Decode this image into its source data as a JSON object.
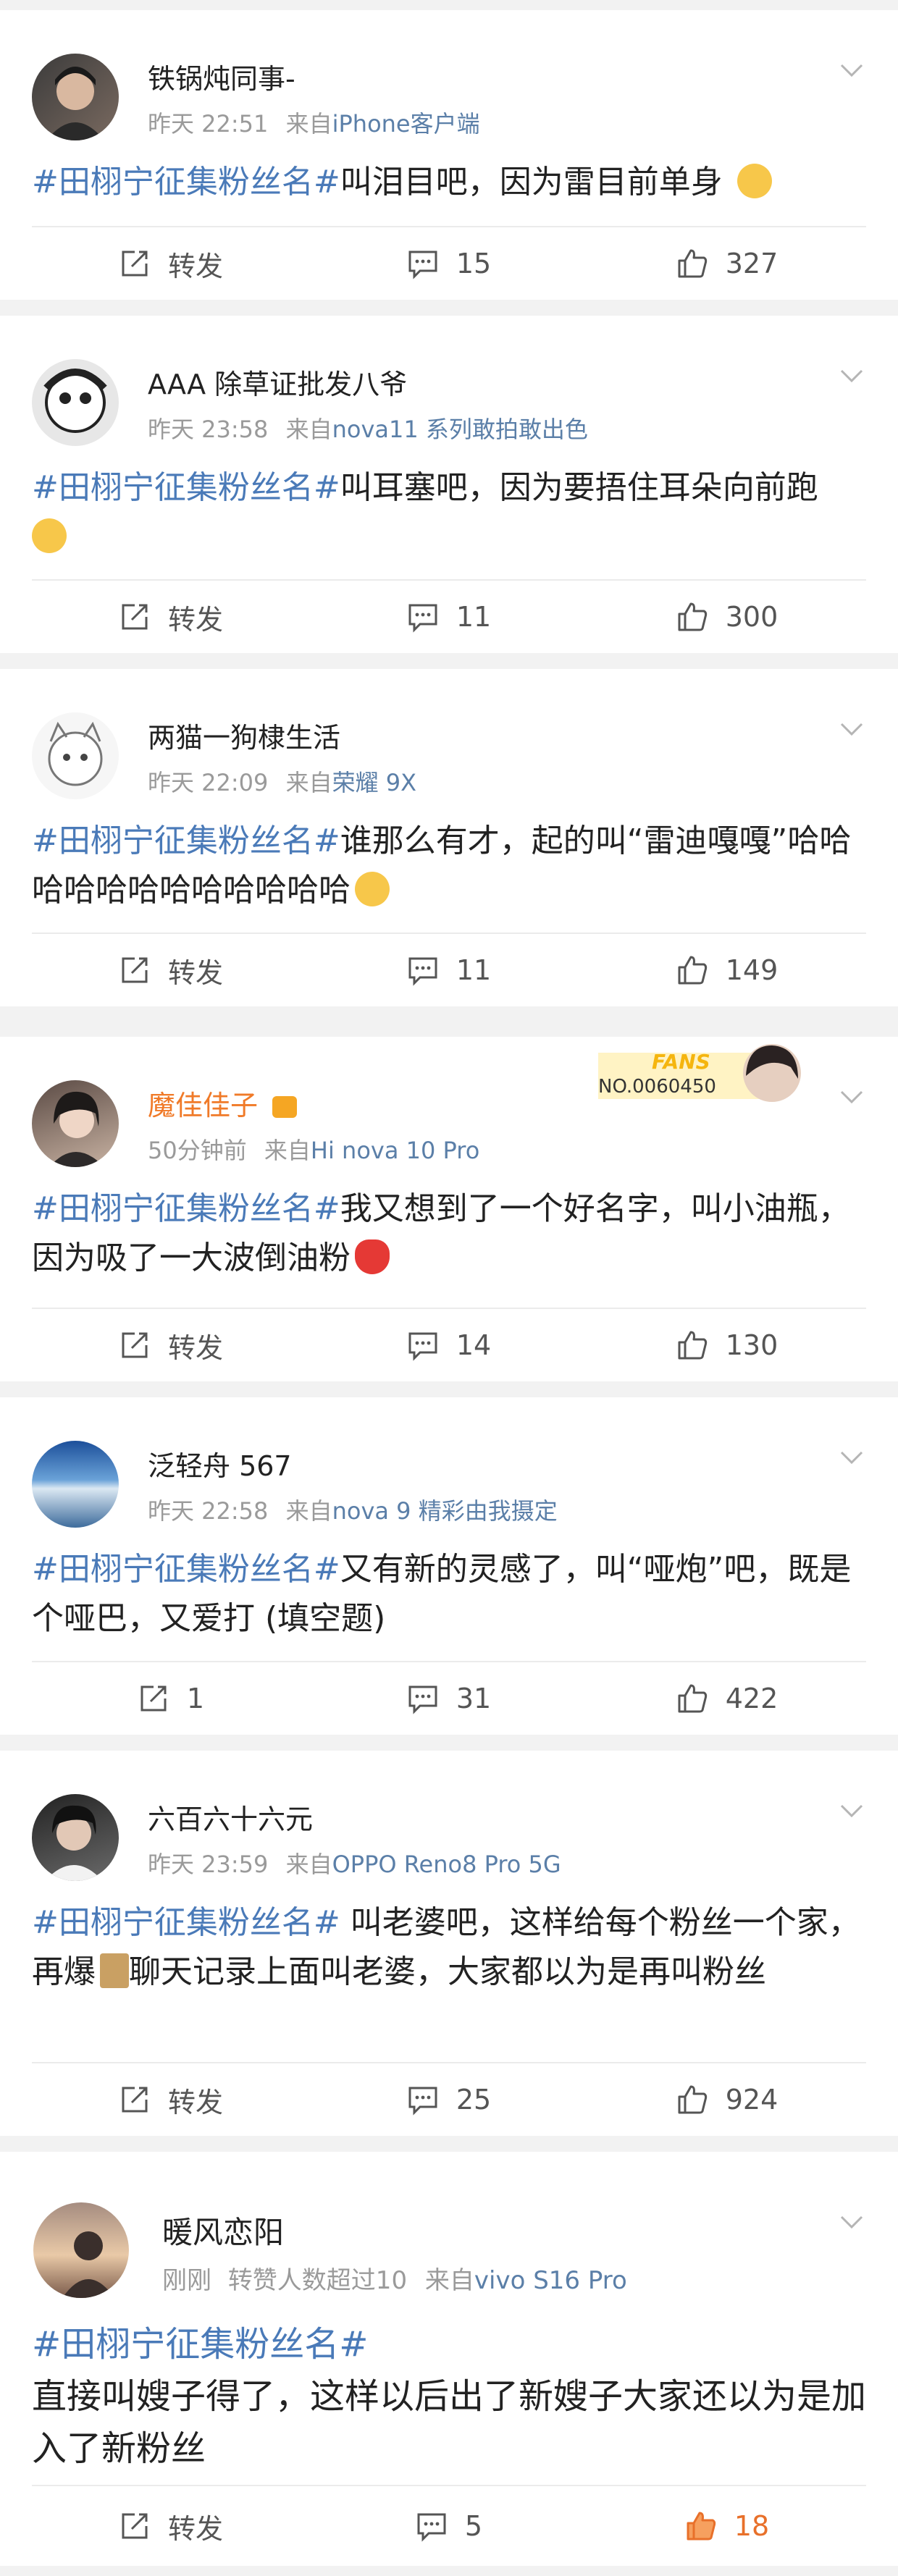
{
  "posts": [
    {
      "name": "铁锅炖同事-",
      "time": "昨天 22:51",
      "from": "来自",
      "source": "iPhone客户端",
      "hashtag": "#田栩宁征集粉丝名#",
      "text": "叫泪目吧，因为雷目前单身",
      "emoji": "crying-face-emoji",
      "repost": "转发",
      "comments": "15",
      "likes": "327"
    },
    {
      "name": "AAA 除草证批发八爷",
      "time": "昨天 23:58",
      "from": "来自",
      "source": "nova11 系列敢拍敢出色",
      "hashtag": "#田栩宁征集粉丝名#",
      "text": "叫耳塞吧，因为要捂住耳朵向前跑",
      "emoji": "covering-ears-emoji",
      "repost": "转发",
      "comments": "11",
      "likes": "300"
    },
    {
      "name": "两猫一狗棣生活",
      "time": "昨天 22:09",
      "from": "来自",
      "source": "荣耀 9X",
      "hashtag": "#田栩宁征集粉丝名#",
      "text": "谁那么有才，起的叫“雷迪嘎嘎”哈哈哈哈哈哈哈哈哈哈哈哈",
      "emoji": "laughing-tears-emoji",
      "repost": "转发",
      "comments": "11",
      "likes": "149"
    },
    {
      "name": "魔佳佳子",
      "time": "50分钟前",
      "from": "来自",
      "source": "Hi nova 10 Pro",
      "hashtag": "#田栩宁征集粉丝名#",
      "text": "我又想到了一个好名字，叫小油瓶，因为吸了一大波倒油粉",
      "emoji": "red-heart-emoji",
      "repost": "转发",
      "comments": "14",
      "likes": "130",
      "fans_badge": "FANS",
      "fans_no": "NO.0060450"
    },
    {
      "name": "泛轻舟 567",
      "time": "昨天 22:58",
      "from": "来自",
      "source": "nova 9 精彩由我摄定",
      "hashtag": "#田栩宁征集粉丝名#",
      "text": "又有新的灵感了，叫“哑炮”吧，既是个哑巴，又爱打 (填空题)",
      "repost": "1",
      "comments": "31",
      "likes": "422"
    },
    {
      "name": "六百六十六元",
      "time": "昨天 23:59",
      "from": "来自",
      "source": "OPPO Reno8 Pro 5G",
      "hashtag": "#田栩宁征集粉丝名#",
      "text": " 叫老婆吧，这样给每个粉丝一个家，再爆",
      "text2": "聊天记录上面叫老婆，大家都以为是再叫粉丝",
      "emoji": "broom-emoji",
      "repost": "转发",
      "comments": "25",
      "likes": "924"
    },
    {
      "name": "暖风恋阳",
      "time": "刚刚",
      "extra": "转赞人数超过10",
      "from": "来自",
      "source": "vivo S16 Pro",
      "hashtag": "#田栩宁征集粉丝名#",
      "text": "直接叫嫂子得了，这样以后出了新嫂子大家还以为是加入了新粉丝",
      "repost": "转发",
      "comments": "5",
      "likes": "18"
    }
  ],
  "colors": {
    "accent": "#4a7ab8",
    "liked": "#e8702a",
    "orange_name": "#f07a28"
  }
}
